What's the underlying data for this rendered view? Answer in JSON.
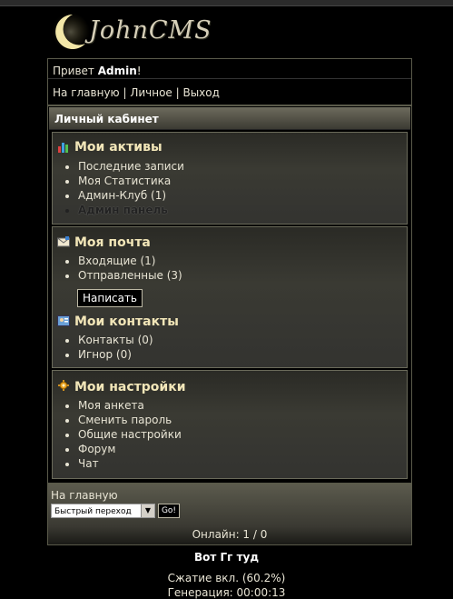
{
  "logo": {
    "text": "JohnCMS"
  },
  "greeting": {
    "prefix": "Привет ",
    "user": "Admin",
    "suffix": "!"
  },
  "topnav": {
    "home": "На главную",
    "personal": "Личное",
    "exit": "Выход",
    "sep": " | "
  },
  "cabinet": {
    "title": "Личный кабинет",
    "assets": {
      "title": "Мои активы",
      "items": [
        "Последние записи",
        "Моя Статистика",
        "Админ-Клуб (1)",
        "Админ панель"
      ]
    },
    "mail": {
      "title": "Моя почта",
      "items": [
        "Входящие (1)",
        "Отправленные (3)"
      ],
      "write_label": "Написать"
    },
    "contacts": {
      "title": "Мои контакты",
      "items": [
        "Контакты (0)",
        "Игнор (0)"
      ]
    },
    "settings": {
      "title": "Мои настройки",
      "items": [
        "Моя анкета",
        "Сменить пароль",
        "Общие настройки",
        "Форум",
        "Чат"
      ]
    }
  },
  "footer": {
    "home": "На главную",
    "quick_jump": "Быстрый переход",
    "go_label": "Go!",
    "online": "Онлайн: 1 / 0"
  },
  "bottom": {
    "title": "Вот Гг туд",
    "compression": "Сжатие вкл. (60.2%)",
    "generation": "Генерация: 00:00:13"
  },
  "colors": {
    "background": "#000000",
    "heading": "#f2e6b8",
    "block_border": "#6a6a5a"
  }
}
